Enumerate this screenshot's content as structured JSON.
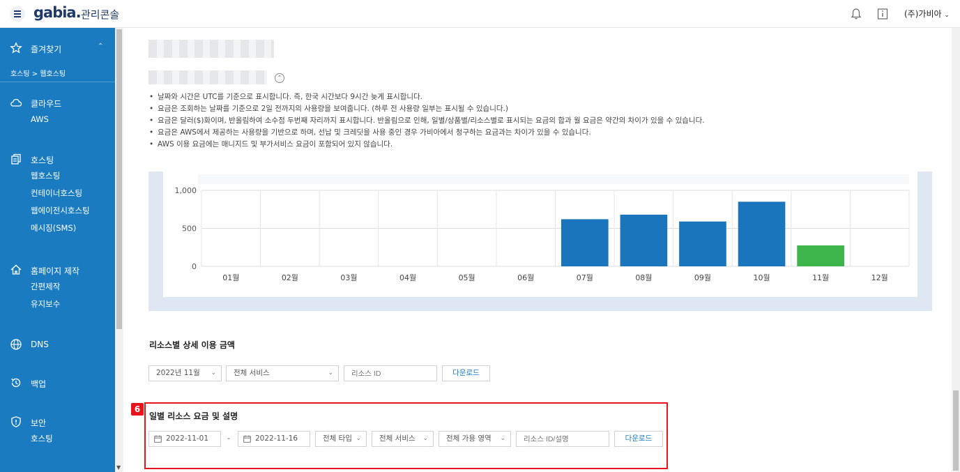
{
  "header": {
    "logo": "gabia.",
    "title": "관리콘솔",
    "account": "(주)가비아"
  },
  "sidebar": {
    "favorites": "즐겨찾기",
    "breadcrumb": "호스팅 > 웹호스팅",
    "sections": [
      {
        "title": "클라우드",
        "items": [
          "AWS"
        ]
      },
      {
        "title": "호스팅",
        "items": [
          "웹호스팅",
          "컨테이너호스팅",
          "웹에이전시호스팅",
          "메시징(SMS)"
        ]
      },
      {
        "title": "홈페이지 제작",
        "items": [
          "간편제작",
          "유지보수"
        ]
      },
      {
        "title": "DNS",
        "items": []
      },
      {
        "title": "백업",
        "items": []
      },
      {
        "title": "보안",
        "items": [
          "호스팅"
        ]
      }
    ]
  },
  "notes": [
    "날짜와 시간은 UTC를 기준으로 표시합니다. 즉, 한국 시간보다 9시간 늦게 표시합니다.",
    "요금은 조회하는 날짜를 기준으로 2일 전까지의 사용량을 보여줍니다. (하루 전 사용량 일부는 표시될 수 있습니다.)",
    "요금은 달러($)화이며, 반올림하여 소수점 두번째 자리까지 표시합니다. 반올림으로 인해, 일별/상품별/리소스별로 표시되는 요금의 합과 월 요금은 약간의 차이가 있을 수 있습니다.",
    "요금은 AWS에서 제공하는 사용량을 기반으로 하며, 선납 및 크레딧을 사용 중인 경우 가비아에서 청구하는 요금과는 차이가 있을 수 있습니다.",
    "AWS 이용 요금에는 매니지드 및 부가서비스 요금이 포함되어 있지 않습니다."
  ],
  "chart_data": {
    "type": "bar",
    "categories": [
      "01월",
      "02월",
      "03월",
      "04월",
      "05월",
      "06월",
      "07월",
      "08월",
      "09월",
      "10월",
      "11월",
      "12월"
    ],
    "values": [
      0,
      0,
      0,
      0,
      0,
      0,
      620,
      680,
      590,
      850,
      275,
      0
    ],
    "yticks": [
      "0",
      "500",
      "1,000"
    ],
    "ylim": [
      0,
      1000
    ],
    "colors": {
      "default": "#1b75bc",
      "current": "#3db54a"
    },
    "current_index": 10
  },
  "resource_section": {
    "title": "리소스별 상세 이용 금액",
    "month": "2022년 11월",
    "service": "전체 서비스",
    "resource_placeholder": "리소스 ID",
    "download": "다운로드"
  },
  "daily_section": {
    "badge": "6",
    "title": "일별 리소스 요금 및 설명",
    "start_date": "2022-11-01",
    "dash": "-",
    "end_date": "2022-11-16",
    "type": "전체 타입",
    "service": "전체 서비스",
    "zone": "전체 가용 영역",
    "resource_placeholder": "리소스 ID/설명",
    "download": "다운로드"
  }
}
